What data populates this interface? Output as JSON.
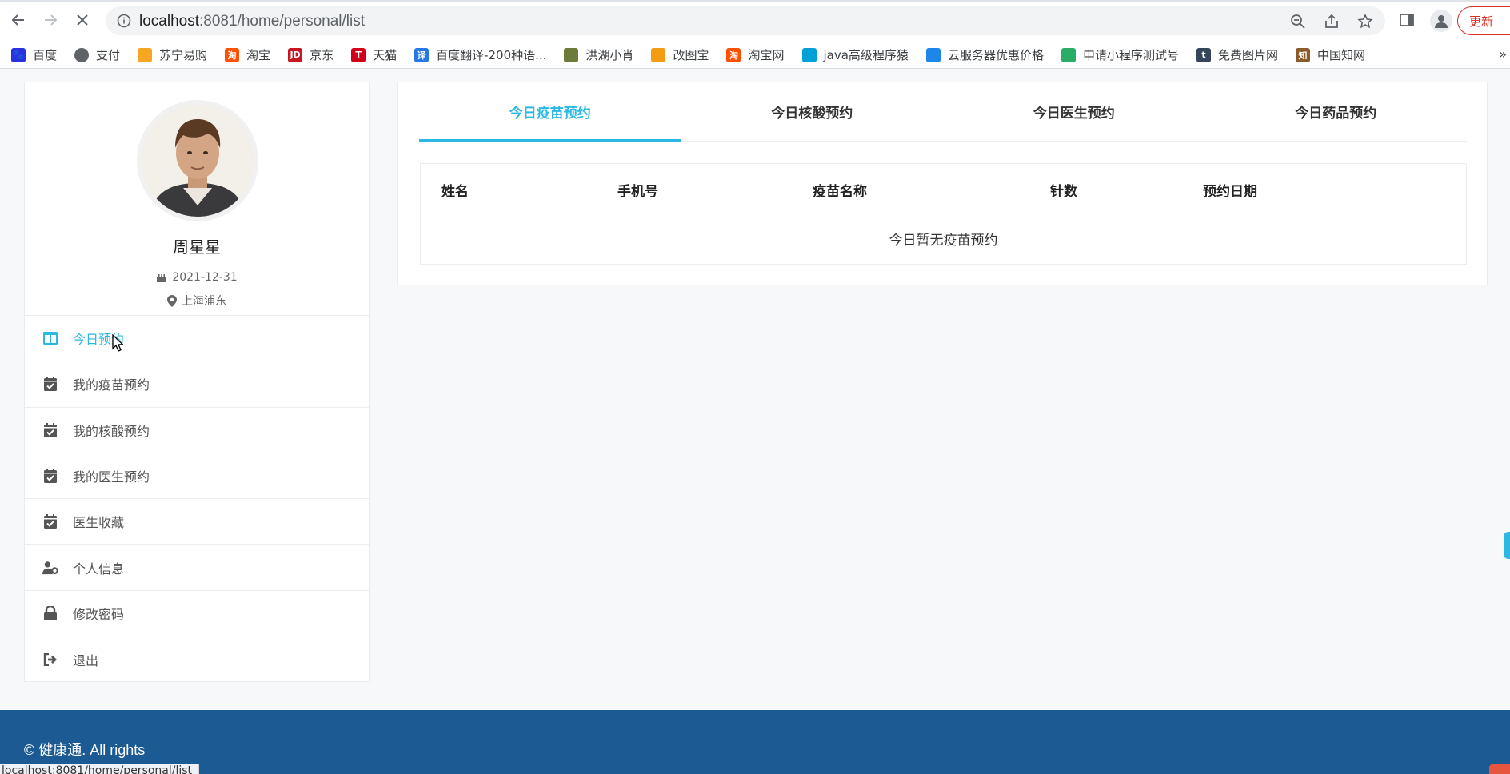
{
  "browser": {
    "url_host": "localhost",
    "url_rest": ":8081/home/personal/list",
    "update_label": "更新",
    "status_url": "localhost:8081/home/personal/list"
  },
  "bookmarks": [
    {
      "label": "百度",
      "icon": "baidu-icon",
      "color": "#2932e1",
      "glyph": "🐾"
    },
    {
      "label": "支付",
      "icon": "globe-icon",
      "color": "#5f6368",
      "glyph": ""
    },
    {
      "label": "苏宁易购",
      "icon": "suning-icon",
      "color": "#f5a623",
      "glyph": ""
    },
    {
      "label": "淘宝",
      "icon": "taobao-icon",
      "color": "#ff5000",
      "glyph": "淘"
    },
    {
      "label": "京东",
      "icon": "jd-icon",
      "color": "#c81623",
      "glyph": "JD"
    },
    {
      "label": "天猫",
      "icon": "tmall-icon",
      "color": "#d1001a",
      "glyph": "T"
    },
    {
      "label": "百度翻译-200种语...",
      "icon": "baidu-translate-icon",
      "color": "#2577e3",
      "glyph": "译"
    },
    {
      "label": "洪湖小肖",
      "icon": "hongcaishi-icon",
      "color": "#6b7c3a",
      "glyph": ""
    },
    {
      "label": "改图宝",
      "icon": "gaitubao-icon",
      "color": "#f39c12",
      "glyph": ""
    },
    {
      "label": "淘宝网",
      "icon": "taobao-net-icon",
      "color": "#ff5000",
      "glyph": "淘"
    },
    {
      "label": "java高级程序猿",
      "icon": "bilibili-icon",
      "color": "#00a1d6",
      "glyph": ""
    },
    {
      "label": "云服务器优惠价格",
      "icon": "cloud-icon",
      "color": "#1c87e8",
      "glyph": ""
    },
    {
      "label": "申请小程序测试号",
      "icon": "wechat-icon",
      "color": "#2aae67",
      "glyph": ""
    },
    {
      "label": "免费图片网",
      "icon": "tumblr-icon",
      "color": "#35465c",
      "glyph": "t"
    },
    {
      "label": "中国知网",
      "icon": "cnki-icon",
      "color": "#8a5a2b",
      "glyph": "知"
    }
  ],
  "profile": {
    "name": "周星星",
    "birthday": "2021-12-31",
    "location": "上海浦东"
  },
  "menu": [
    {
      "label": "今日预约",
      "icon": "columns-icon",
      "active": true
    },
    {
      "label": "我的疫苗预约",
      "icon": "calendar-check-icon",
      "active": false
    },
    {
      "label": "我的核酸预约",
      "icon": "calendar-check-icon",
      "active": false
    },
    {
      "label": "我的医生预约",
      "icon": "calendar-check-icon",
      "active": false
    },
    {
      "label": "医生收藏",
      "icon": "calendar-check-icon",
      "active": false
    },
    {
      "label": "个人信息",
      "icon": "user-gear-icon",
      "active": false
    },
    {
      "label": "修改密码",
      "icon": "lock-icon",
      "active": false
    },
    {
      "label": "退出",
      "icon": "sign-out-icon",
      "active": false
    }
  ],
  "tabs": [
    {
      "label": "今日疫苗预约",
      "active": true
    },
    {
      "label": "今日核酸预约",
      "active": false
    },
    {
      "label": "今日医生预约",
      "active": false
    },
    {
      "label": "今日药品预约",
      "active": false
    }
  ],
  "table": {
    "headers": [
      "姓名",
      "手机号",
      "疫苗名称",
      "针数",
      "预约日期"
    ],
    "empty_text": "今日暂无疫苗预约"
  },
  "footer": {
    "text": "© 健康通. All rights"
  },
  "colors": {
    "accent": "#2bb8e3",
    "footer_bg": "#1b5a92"
  }
}
